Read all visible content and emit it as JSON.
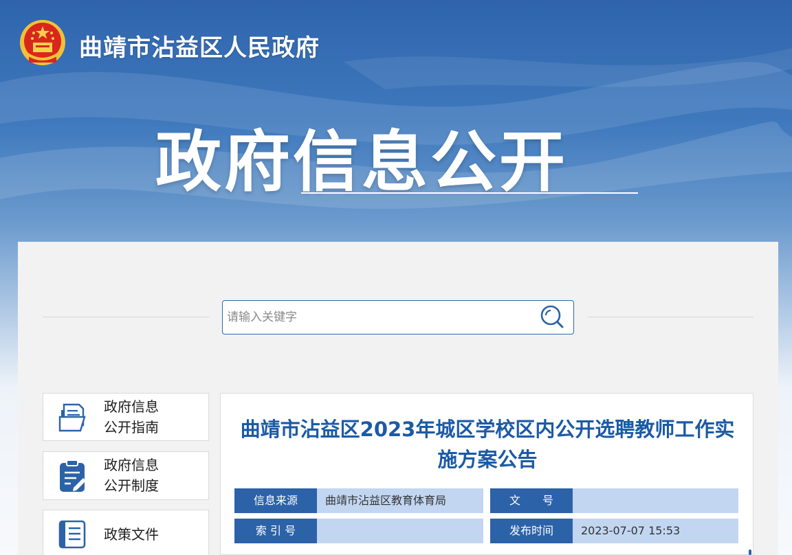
{
  "header": {
    "site_title": "曲靖市沾益区人民政府",
    "hero_title": "政府信息公开"
  },
  "search": {
    "placeholder": "请输入关键字"
  },
  "sidebar": {
    "items": [
      {
        "line1": "政府信息",
        "line2": "公开指南",
        "icon": "document-folder-icon"
      },
      {
        "line1": "政府信息",
        "line2": "公开制度",
        "icon": "clipboard-edit-icon"
      },
      {
        "label": "政策文件",
        "icon": "list-document-icon",
        "expand": "plus-icon"
      }
    ]
  },
  "article": {
    "title": "曲靖市沾益区2023年城区学校区内公开选聘教师工作实施方案公告",
    "meta": {
      "source_label": "信息来源",
      "source_value": "曲靖市沾益区教育体育局",
      "doc_no_label": "文　　号",
      "doc_no_value": "",
      "index_label": "索 引 号",
      "index_value": "",
      "date_label": "发布时间",
      "date_value": "2023-07-07 15:53"
    }
  },
  "colors": {
    "primary": "#2c62a8",
    "title_blue": "#1b5aa6",
    "meta_value_bg": "#c2d6f1"
  }
}
